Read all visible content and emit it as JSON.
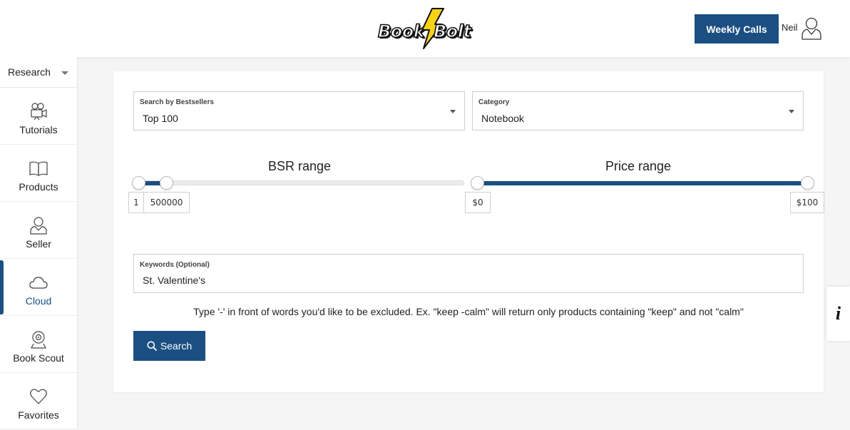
{
  "header": {
    "logo_part1": "Book",
    "logo_part2": "Bolt",
    "weekly_calls_label": "Weekly Calls",
    "user_name": "Neil"
  },
  "sidebar": {
    "select_value": "Research",
    "items": [
      {
        "label": "Tutorials",
        "icon": "video-camera-icon",
        "active": false
      },
      {
        "label": "Products",
        "icon": "book-icon",
        "active": false
      },
      {
        "label": "Seller",
        "icon": "person-icon",
        "active": false
      },
      {
        "label": "Cloud",
        "icon": "cloud-icon",
        "active": true
      },
      {
        "label": "Book Scout",
        "icon": "webcam-icon",
        "active": false
      },
      {
        "label": "Favorites",
        "icon": "heart-icon",
        "active": false
      }
    ]
  },
  "search": {
    "bestsellers_label": "Search by Bestsellers",
    "bestsellers_value": "Top 100",
    "category_label": "Category",
    "category_value": "Notebook",
    "bsr_title": "BSR range",
    "bsr_min": "1",
    "bsr_max": "500000",
    "price_title": "Price range",
    "price_min": "$0",
    "price_max": "$100",
    "keywords_label": "Keywords (Optional)",
    "keywords_value": "St. Valentine's",
    "hint": "Type '-' in front of words you'd like to be excluded. Ex. \"keep -calm\" will return only products containing \"keep\" and not \"calm\"",
    "search_label": "Search"
  },
  "info_tab": "i",
  "colors": {
    "accent": "#1b4f82",
    "bolt_yellow": "#f7d117"
  }
}
